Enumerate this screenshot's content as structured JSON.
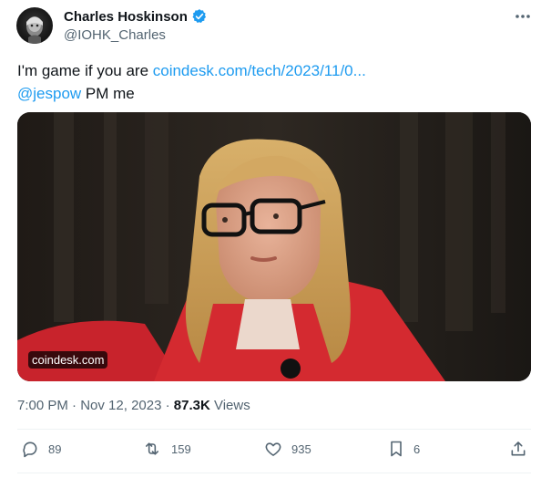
{
  "author": {
    "name": "Charles Hoskinson",
    "handle": "@IOHK_Charles",
    "verified": true
  },
  "tweet": {
    "text_prefix": "I'm game if you are ",
    "link": "coindesk.com/tech/2023/11/0...",
    "mention": "@jespow",
    "text_suffix": " PM me"
  },
  "media": {
    "source_label": "coindesk.com"
  },
  "meta": {
    "time": "7:00 PM",
    "separator": "·",
    "date": "Nov 12, 2023",
    "views_count": "87.3K",
    "views_label": " Views"
  },
  "actions": {
    "replies": "89",
    "reposts": "159",
    "likes": "935",
    "bookmarks": "6"
  },
  "colors": {
    "link": "#1d9bf0",
    "secondary_text": "#536471",
    "verified_badge": "#1d9bf0"
  },
  "icons": [
    "more-icon",
    "verified-badge-icon",
    "reply-icon",
    "repost-icon",
    "like-icon",
    "bookmark-icon",
    "share-icon"
  ]
}
